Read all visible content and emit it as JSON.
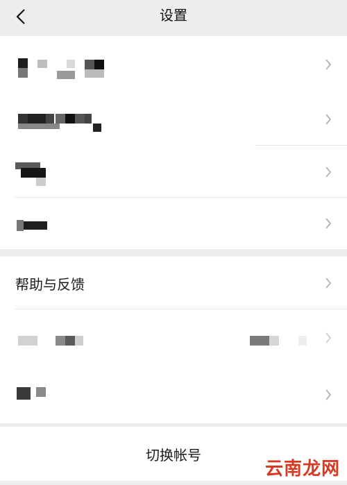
{
  "header": {
    "title": "设置",
    "back_icon": "chevron-left-icon"
  },
  "group1": {
    "rows": [
      {
        "label": "",
        "obscured": true
      },
      {
        "label": "",
        "obscured": true
      },
      {
        "label": "",
        "obscured": true
      },
      {
        "label": "",
        "obscured": true
      }
    ]
  },
  "group2": {
    "rows": [
      {
        "label": "帮助与反馈"
      },
      {
        "label": "",
        "obscured": true
      },
      {
        "label": "",
        "obscured": true
      }
    ]
  },
  "footer": {
    "switch_account_label": "切换帐号"
  },
  "watermark": {
    "text": "云南龙网"
  },
  "colors": {
    "background": "#ededed",
    "row": "#ffffff",
    "watermark": "#d63a22"
  }
}
